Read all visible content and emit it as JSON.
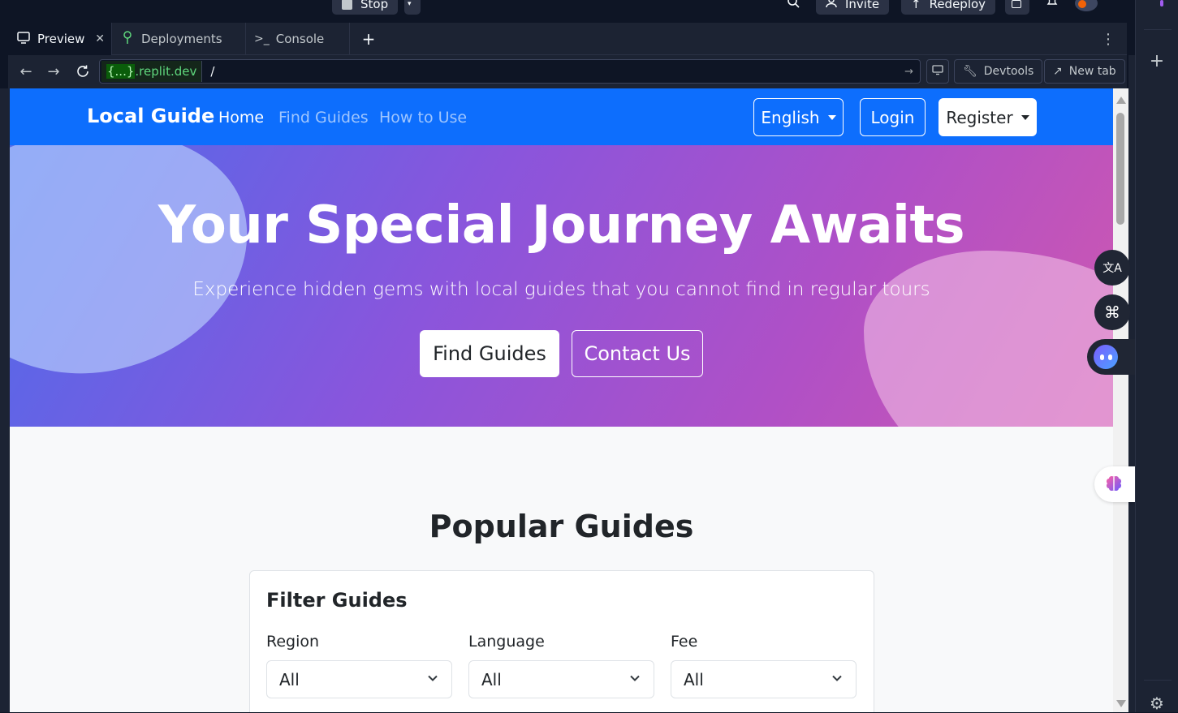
{
  "topbar": {
    "stop_label": "Stop",
    "invite_label": "Invite",
    "redeploy_label": "Redeploy"
  },
  "tabs": [
    {
      "label": "Preview",
      "active": true
    },
    {
      "label": "Deployments",
      "active": false
    },
    {
      "label": "Console",
      "active": false
    }
  ],
  "urlbar": {
    "host_highlight": "{...}",
    "host_domain": ".replit.dev",
    "path": "/",
    "devtools_label": "Devtools",
    "newtab_label": "New tab"
  },
  "site": {
    "brand": "Local Guide",
    "nav": [
      {
        "label": "Home",
        "active": true
      },
      {
        "label": "Find Guides",
        "active": false
      },
      {
        "label": "How to Use",
        "active": false
      }
    ],
    "language_label": "English",
    "login_label": "Login",
    "register_label": "Register",
    "hero": {
      "title": "Your Special Journey Awaits",
      "subtitle": "Experience hidden gems with local guides that you cannot find in regular tours",
      "primary_cta": "Find Guides",
      "secondary_cta": "Contact Us"
    },
    "popular": {
      "title": "Popular Guides",
      "filter": {
        "title": "Filter Guides",
        "fields": [
          {
            "label": "Region",
            "value": "All"
          },
          {
            "label": "Language",
            "value": "All"
          },
          {
            "label": "Fee",
            "value": "All"
          }
        ]
      }
    }
  },
  "colors": {
    "brand_blue": "#0d6efd",
    "ide_bg": "#0e1525",
    "ide_panel": "#1c2333",
    "url_green": "#5fd77d"
  }
}
